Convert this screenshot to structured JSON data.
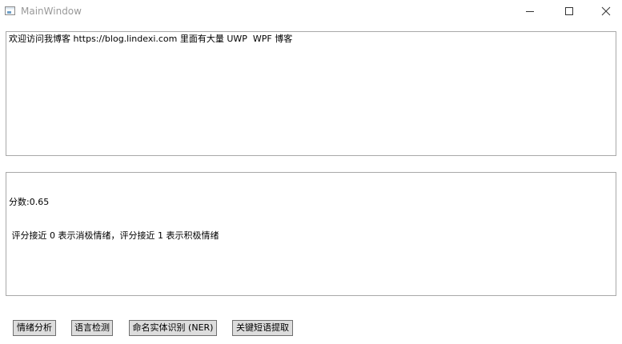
{
  "window": {
    "title": "MainWindow"
  },
  "input": {
    "text": "欢迎访问我博客 https://blog.lindexi.com 里面有大量 UWP  WPF 博客"
  },
  "output": {
    "line1": "分数:0.65",
    "line2": " 评分接近 0 表示消极情绪，评分接近 1 表示积极情绪"
  },
  "buttons": {
    "sentiment": "情绪分析",
    "language": "语言检测",
    "ner": "命名实体识别 (NER)",
    "keyphrase": "关键短语提取"
  }
}
